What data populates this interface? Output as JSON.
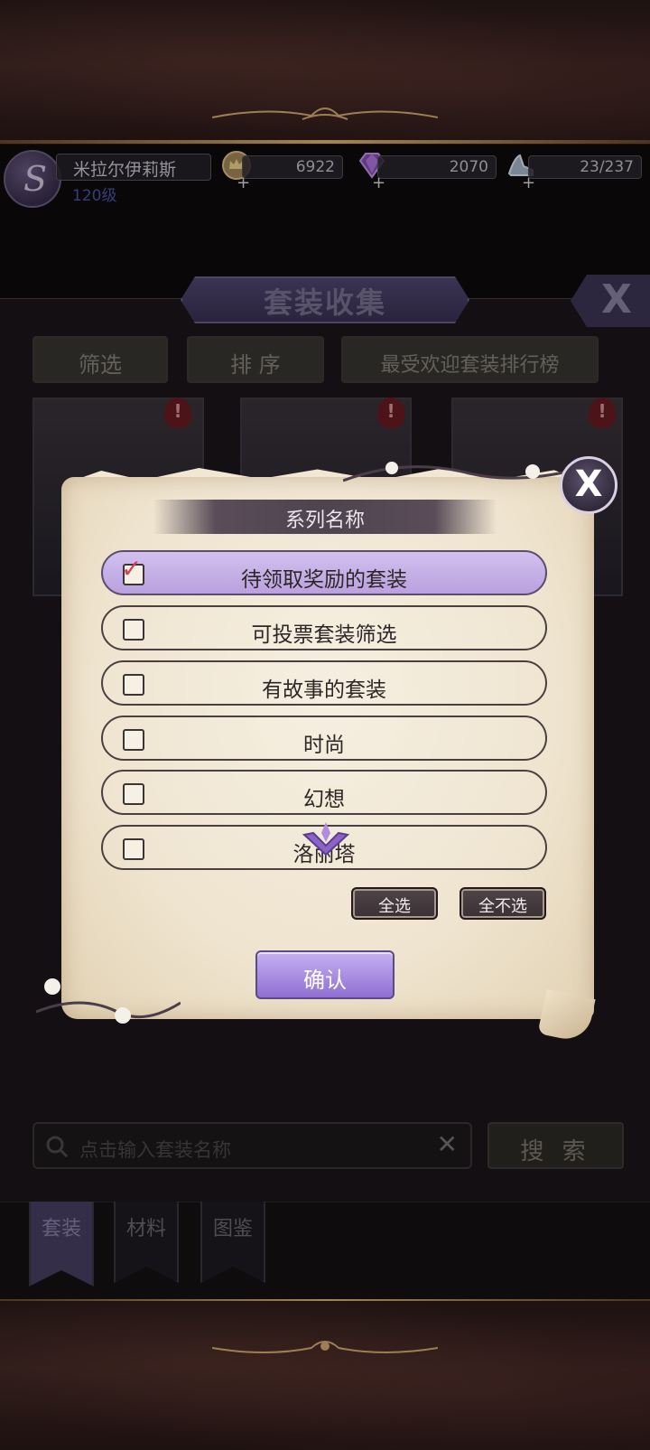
{
  "player": {
    "name": "米拉尔伊莉斯",
    "level": "120级",
    "avatar_glyph": "S"
  },
  "resources": [
    {
      "icon": "crown-coin-icon",
      "value": "6922"
    },
    {
      "icon": "purple-diamond-icon",
      "value": "2070"
    },
    {
      "icon": "crystal-shoe-icon",
      "value": "23/237"
    }
  ],
  "window": {
    "title": "套装收集",
    "close_label": "X",
    "tabs": [
      "筛选",
      "排 序",
      "最受欢迎套装排行榜"
    ],
    "alert_mark": "!",
    "search_placeholder": "点击输入套装名称",
    "search_clear": "✕",
    "search_button": "搜 索",
    "side_tabs": [
      "套装",
      "材料",
      "图鉴"
    ]
  },
  "dialog": {
    "title": "系列名称",
    "close_label": "X",
    "options": [
      {
        "label": "待领取奖励的套装",
        "checked": true
      },
      {
        "label": "可投票套装筛选",
        "checked": false
      },
      {
        "label": "有故事的套装",
        "checked": false
      },
      {
        "label": "时尚",
        "checked": false
      },
      {
        "label": "幻想",
        "checked": false
      },
      {
        "label": "洛丽塔",
        "checked": false
      }
    ],
    "check_mark": "✓",
    "select_all": "全选",
    "select_none": "全不选",
    "confirm": "确认"
  },
  "colors": {
    "accent_purple": "#b9a1de",
    "gold": "#e2b877",
    "parchment": "#efe4cf"
  }
}
